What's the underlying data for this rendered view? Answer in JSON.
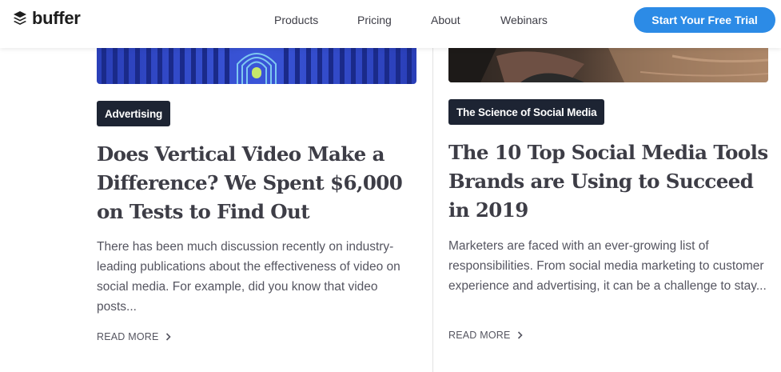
{
  "brand": {
    "name": "buffer",
    "accent": "#2c8be6"
  },
  "nav": {
    "links": [
      "Products",
      "Pricing",
      "About",
      "Webinars"
    ],
    "cta": "Start Your Free Trial"
  },
  "articles": [
    {
      "tag": "Advertising",
      "title": "Does Vertical Video Make a Difference? We Spent $6,000 on Tests to Find Out",
      "excerpt": "There has been much discussion recently on industry-leading publications about the effectiveness of video on social media. For example, did you know that video posts...",
      "read_more": "READ MORE"
    },
    {
      "tag": "The Science of Social Media",
      "title": "The 10 Top Social Media Tools Brands are Using to Succeed in 2019",
      "excerpt": "Marketers are faced with an ever-growing list of responsibilities. From social media marketing to customer experience and advertising, it can be a challenge to stay...",
      "read_more": "READ MORE"
    }
  ]
}
